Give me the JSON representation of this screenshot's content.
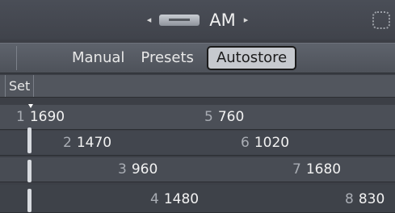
{
  "header": {
    "band": "AM",
    "left_arrow": "◂",
    "right_arrow": "▸"
  },
  "tabs": [
    {
      "label": "Manual"
    },
    {
      "label": "Presets"
    },
    {
      "label": "Autostore",
      "active": true
    }
  ],
  "set_label": "Set",
  "presets": [
    {
      "num": "1",
      "freq": "1690"
    },
    {
      "num": "2",
      "freq": "1470"
    },
    {
      "num": "3",
      "freq": "960"
    },
    {
      "num": "4",
      "freq": "1480"
    },
    {
      "num": "5",
      "freq": "760"
    },
    {
      "num": "6",
      "freq": "1020"
    },
    {
      "num": "7",
      "freq": "1680"
    },
    {
      "num": "8",
      "freq": "830"
    }
  ],
  "icons": {
    "radio": "radio-icon",
    "menu": "menu-icon"
  },
  "colors": {
    "active_tab_bg": "#c6c9ce",
    "background": "#3c3f46"
  }
}
